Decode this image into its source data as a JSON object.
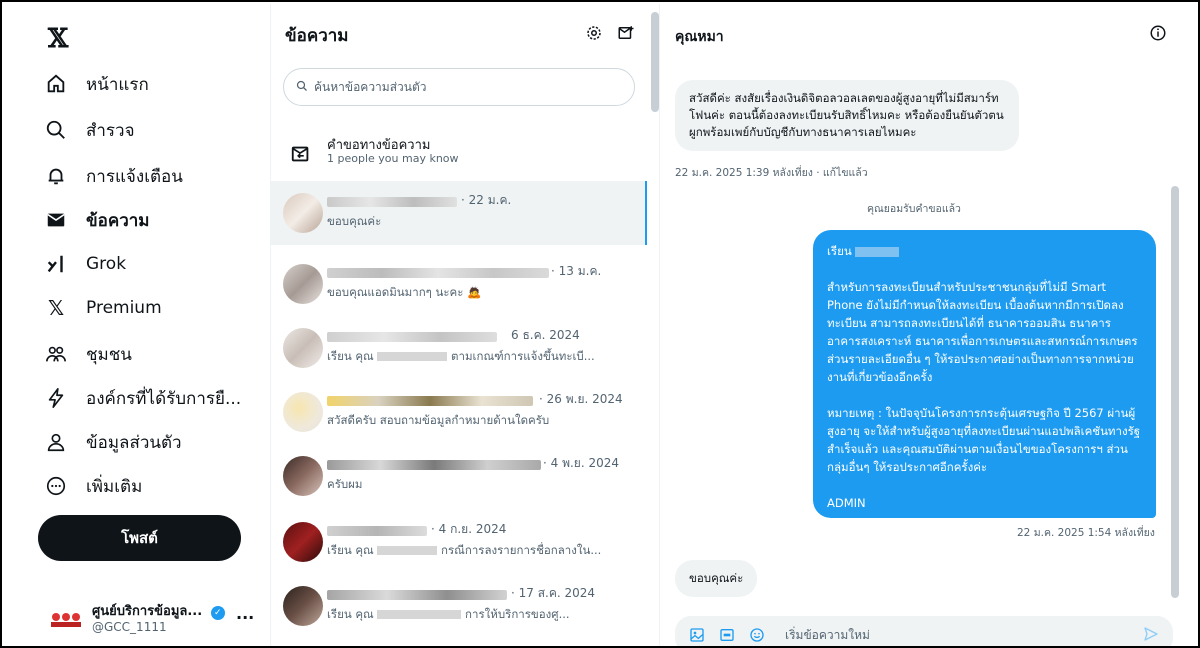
{
  "nav": {
    "items": [
      {
        "label": "หน้าแรก",
        "icon": "home-icon"
      },
      {
        "label": "สำรวจ",
        "icon": "search-icon"
      },
      {
        "label": "การแจ้งเตือน",
        "icon": "bell-icon"
      },
      {
        "label": "ข้อความ",
        "icon": "mail-icon"
      },
      {
        "label": "Grok",
        "icon": "grok-icon"
      },
      {
        "label": "Premium",
        "icon": "x-premium-icon"
      },
      {
        "label": "ชุมชน",
        "icon": "communities-icon"
      },
      {
        "label": "องค์กรที่ได้รับการยื...",
        "icon": "lightning-icon"
      },
      {
        "label": "ข้อมูลส่วนตัว",
        "icon": "profile-icon"
      },
      {
        "label": "เพิ่มเติม",
        "icon": "more-circle-icon"
      }
    ],
    "post_label": "โพสต์",
    "account": {
      "name": "ศูนย์บริการข้อมูล...",
      "handle": "@GCC_1111",
      "more": "..."
    }
  },
  "messages": {
    "title": "ข้อความ",
    "search_placeholder": "ค้นหาข้อความส่วนตัว",
    "request_title": "คำขอทางข้อความ",
    "request_sub": "1 people you may know",
    "conversations": [
      {
        "date": "· 22 ม.ค.",
        "preview": "ขอบคุณค่ะ",
        "selected": true
      },
      {
        "date": "· 13 ม.ค.",
        "preview": "ขอบคุณแอดมินมากๆ นะคะ 🙇"
      },
      {
        "date": "6 ธ.ค. 2024",
        "preview": "เรียน คุณ",
        "preview_tail": "ตามเกณฑ์การแจ้งขึ้นทะเบี..."
      },
      {
        "date": "· 26 พ.ย. 2024",
        "preview": "สวัสดีครับ สอบถามข้อมูลกำหมายด้านใดครับ"
      },
      {
        "date": "· 4 พ.ย. 2024",
        "preview": "ครับผม"
      },
      {
        "date": "· 4 ก.ย. 2024",
        "preview": "เรียน คุณ",
        "preview_tail": "กรณีการลงรายการชื่อกลางใน..."
      },
      {
        "date": "· 17 ส.ค. 2024",
        "preview": "เรียน คุณ",
        "preview_tail": "การให้บริการของศู..."
      }
    ]
  },
  "chat": {
    "title": "คุณหมา",
    "incoming_1": "สวัสดีค่ะ สงสัยเรื่องเงินดิจิตอลวอลเลตของผู้สูงอายุที่ไม่มีสมาร์ทโฟนค่ะ ตอนนี้ต้องลงทะเบียนรับสิทธิ์ไหมคะ หรือต้องยืนยันตัวตน ผูกพร้อมเพย์กับบัญชีกับทางธนาคารเลยไหมคะ",
    "incoming_1_meta": "22 ม.ค. 2025 1:39 หลังเที่ยง · แก้ไขแล้ว",
    "accepted_note": "คุณยอมรับคำขอแล้ว",
    "outgoing": {
      "greeting": "เรียน",
      "para1": "สำหรับการลงทะเบียนสำหรับประชาชนกลุ่มที่ไม่มี Smart Phone ยังไม่มีกำหนดให้ลงทะเบียน เบื้องต้นหากมีการเปิดลงทะเบียน สามารถลงทะเบียนได้ที่ ธนาคารออมสิน ธนาคารอาคารสงเคราะห์ ธนาคารเพื่อการเกษตรและสหกรณ์การเกษตร ส่วนรายละเอียดอื่น ๆ ให้รอประกาศอย่างเป็นทางการจากหน่วยงานที่เกี่ยวข้องอีกครั้ง",
      "para2": "หมายเหตุ : ในปัจจุบันโครงการกระตุ้นเศรษฐกิจ ปี 2567 ผ่านผู้สูงอายุ จะให้สำหรับผู้สูงอายุที่ลงทะเบียนผ่านแอปพลิเคชันทางรัฐสำเร็จแล้ว และคุณสมบัติผ่านตามเงื่อนไขของโครงการฯ ส่วนกลุ่มอื่นๆ ให้รอประกาศอีกครั้งค่ะ",
      "signature": "ADMIN"
    },
    "outgoing_meta": "22 ม.ค. 2025 1:54 หลังเที่ยง",
    "incoming_2": "ขอบคุณค่ะ",
    "compose_placeholder": "เริ่มข้อความใหม่"
  },
  "colors": {
    "accent": "#1d9bf0",
    "text": "#0f1419",
    "muted": "#536471",
    "bubble_in": "#eff3f4"
  }
}
